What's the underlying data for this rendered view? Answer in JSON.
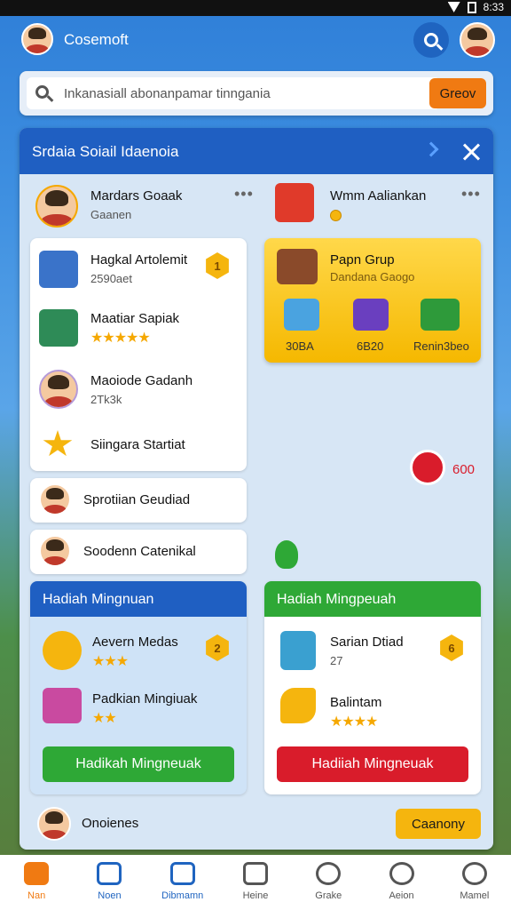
{
  "status_bar": {
    "time": "8:33"
  },
  "header": {
    "title": "Cosemoft"
  },
  "search": {
    "placeholder": "Inkanasiall abonanpamar tinngania",
    "button_label": "Greov"
  },
  "panel": {
    "title": "Srdaia Soiail Idaenoia",
    "profile_left": {
      "name": "Mardars Goaak",
      "subtitle": "Gaanen"
    },
    "profile_right": {
      "name": "Wmm Aaliankan"
    },
    "list": [
      {
        "name": "Hagkal Artolemit",
        "detail": "2590aet",
        "badge": "1"
      },
      {
        "name": "Maatiar Sapiak",
        "stars": "★★★★★"
      },
      {
        "name": "Maoiode Gadanh",
        "detail": "2Tk3k"
      },
      {
        "name": "Siingara Startiat"
      }
    ],
    "list_extra": [
      {
        "name": "Sprotiian Geudiad"
      },
      {
        "name": "Soodenn Catenikal"
      }
    ],
    "group": {
      "title": "Papn Grup",
      "subtitle": "Dandana Gaogo",
      "items": [
        {
          "label": "30BA"
        },
        {
          "label": "6B20"
        },
        {
          "label": "Renin3beo"
        }
      ]
    },
    "notification_count": "600",
    "reward_left": {
      "title": "Hadiah Mingnuan",
      "items": [
        {
          "name": "Aevern Medas",
          "stars": "★★★",
          "badge": "2"
        },
        {
          "name": "Padkian Mingiuak",
          "stars": "★★"
        }
      ],
      "button": "Hadikah Mingneuak"
    },
    "reward_right": {
      "title": "Hadiah Mingpeuah",
      "items": [
        {
          "name": "Sarian Dtiad",
          "detail": "27",
          "badge": "6"
        },
        {
          "name": "Balintam",
          "stars": "★★★★"
        }
      ],
      "button": "Hadiiah Mingneuak"
    },
    "footer": {
      "name": "Onoienes",
      "button": "Caanony"
    }
  },
  "bottom_nav": [
    {
      "label": "Nan",
      "icon": "home-icon"
    },
    {
      "label": "Noen",
      "icon": "camera-icon"
    },
    {
      "label": "Dibmamn",
      "icon": "inbox-icon"
    },
    {
      "label": "Heine",
      "icon": "pet-icon"
    },
    {
      "label": "Grake",
      "icon": "user-icon"
    },
    {
      "label": "Aeion",
      "icon": "search-user-icon"
    },
    {
      "label": "Mamel",
      "icon": "profile-icon"
    }
  ],
  "colors": {
    "primary": "#1f5fc2",
    "accent": "#f07a12",
    "green": "#2ea836",
    "red": "#d91c2b",
    "nav_active": "#1f64c0"
  }
}
